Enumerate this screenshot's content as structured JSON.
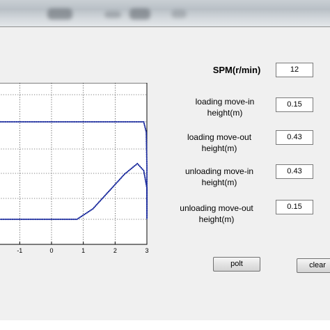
{
  "params": [
    {
      "label": "SPM(r/min)",
      "value": "12",
      "bold": true
    },
    {
      "label": "loading move-in height(m)",
      "value": "0.15"
    },
    {
      "label": "loading move-out height(m)",
      "value": "0.43"
    },
    {
      "label": "unloading move-in height(m)",
      "value": "0.43"
    },
    {
      "label": "unloading move-out height(m)",
      "value": "0.15"
    }
  ],
  "labels": {
    "spm": "SPM(r/min)",
    "load_in_1": "loading move-in",
    "load_in_2": "height(m)",
    "load_out_1": "loading move-out",
    "load_out_2": "height(m)",
    "unload_in_1": "unloading move-in",
    "unload_in_2": "height(m)",
    "unload_out_1": "unloading move-out",
    "unload_out_2": "height(m)"
  },
  "values": {
    "spm": "12",
    "load_in": "0.15",
    "load_out": "0.43",
    "unload_in": "0.43",
    "unload_out": "0.15"
  },
  "buttons": {
    "plot": "polt",
    "clear": "clear"
  },
  "colors": {
    "series": "#1f2f9f",
    "grid": "#000000"
  },
  "chart_data": {
    "type": "line",
    "xticks": [
      "-1",
      "0",
      "1",
      "2",
      "3"
    ],
    "xlim_visible": [
      -2.3,
      3
    ],
    "series": [
      {
        "points": [
          [
            -2.3,
            0.43
          ],
          [
            2.5,
            0.43
          ],
          [
            2.9,
            0.43
          ],
          [
            2.98,
            0.4
          ],
          [
            3.0,
            0.3
          ],
          [
            3.0,
            0.15
          ]
        ]
      },
      {
        "points": [
          [
            -2.3,
            0.18
          ],
          [
            -1.8,
            0.15
          ],
          [
            -1.0,
            0.15
          ],
          [
            0.0,
            0.15
          ],
          [
            0.8,
            0.15
          ],
          [
            1.3,
            0.18
          ],
          [
            1.8,
            0.23
          ],
          [
            2.3,
            0.28
          ],
          [
            2.7,
            0.31
          ],
          [
            2.9,
            0.29
          ],
          [
            3.0,
            0.24
          ],
          [
            3.0,
            0.15
          ]
        ]
      }
    ]
  }
}
